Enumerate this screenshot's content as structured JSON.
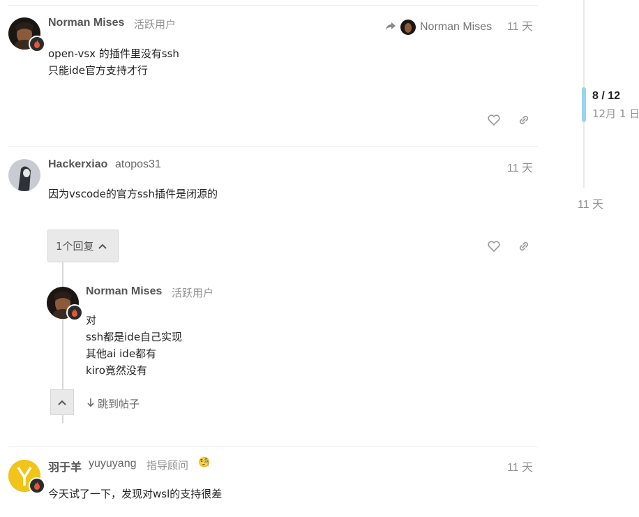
{
  "posts": [
    {
      "username": "Norman Mises",
      "title": "活跃用户",
      "reply_to": "Norman Mises",
      "date": "11 天",
      "body": [
        "open-vsx 的插件里没有ssh",
        "只能ide官方支持才行"
      ]
    },
    {
      "username": "Hackerxiao",
      "subname": "atopos31",
      "date": "11 天",
      "body": [
        "因为vscode的官方ssh插件是闭源的"
      ],
      "replies_label": "1个回复"
    },
    {
      "username": "羽于羊",
      "subname": "yuyuyang",
      "title": "指导顾问",
      "title_emoji": "🧐",
      "date": "11 天",
      "body": [
        "今天试了一下，发现对wsl的支持很差"
      ]
    }
  ],
  "embedded_reply": {
    "username": "Norman Mises",
    "title": "活跃用户",
    "body": [
      "对",
      "ssh都是ide自己实现",
      "其他ai ide都有",
      "kiro竟然没有"
    ],
    "jump_label": "跳到帖子"
  },
  "timeline": {
    "position": "8 / 12",
    "date": "12月 1 日",
    "end_label": "11 天"
  },
  "icons": {
    "like": "heart-icon",
    "link": "link-icon",
    "reply_to": "share-arrow-icon",
    "flair": "flame-icon"
  },
  "colors": {
    "timeline_handle": "#97d4f0",
    "flair_bg": "#2b2b2b",
    "flame": "#e45735",
    "avatar_yellow": "#f0c419"
  }
}
